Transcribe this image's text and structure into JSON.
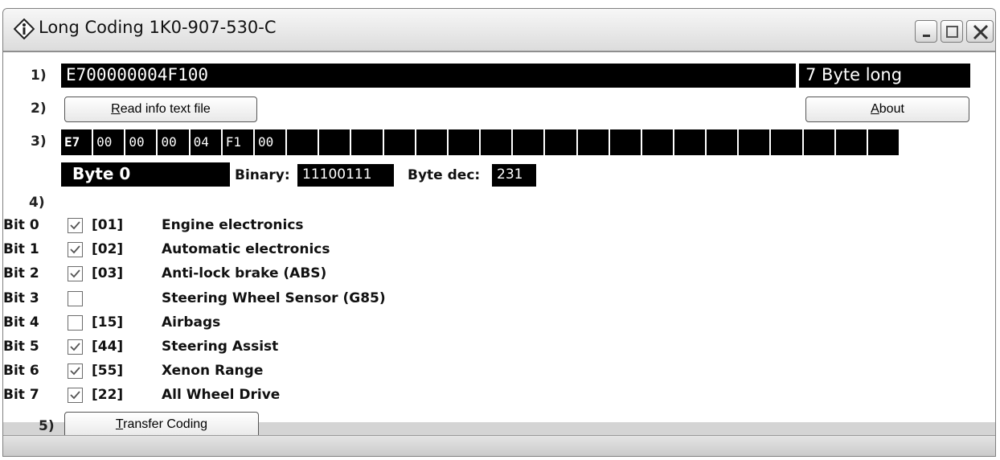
{
  "window": {
    "title": "Long Coding 1K0-907-530-C"
  },
  "rows": {
    "r1": "1)",
    "r2": "2)",
    "r3": "3)",
    "r4": "4)",
    "r5": "5)"
  },
  "coding": {
    "value": "E700000004F100",
    "length": "7 Byte long"
  },
  "buttons": {
    "read_info": {
      "underlined": "R",
      "rest": "ead info text file"
    },
    "about": {
      "underlined": "A",
      "rest": "bout"
    },
    "transfer": {
      "underlined": "T",
      "rest": "ransfer Coding"
    }
  },
  "bytes": [
    "E7",
    "00",
    "00",
    "00",
    "04",
    "F1",
    "00",
    "",
    "",
    "",
    "",
    "",
    "",
    "",
    "",
    "",
    "",
    "",
    "",
    "",
    "",
    "",
    "",
    "",
    "",
    ""
  ],
  "byte_info": {
    "label": "Byte 0",
    "binary_label": "Binary:",
    "binary_value": "11100111",
    "dec_label": "Byte dec:",
    "dec_value": "231"
  },
  "bits": [
    {
      "label": "Bit 0",
      "checked": true,
      "code": "[01]",
      "desc": "Engine electronics"
    },
    {
      "label": "Bit 1",
      "checked": true,
      "code": "[02]",
      "desc": "Automatic electronics"
    },
    {
      "label": "Bit 2",
      "checked": true,
      "code": "[03]",
      "desc": "Anti-lock brake (ABS)"
    },
    {
      "label": "Bit 3",
      "checked": false,
      "code": "",
      "desc": "Steering Wheel Sensor (G85)"
    },
    {
      "label": "Bit 4",
      "checked": false,
      "code": "[15]",
      "desc": "Airbags"
    },
    {
      "label": "Bit 5",
      "checked": true,
      "code": "[44]",
      "desc": "Steering Assist"
    },
    {
      "label": "Bit 6",
      "checked": true,
      "code": "[55]",
      "desc": "Xenon Range"
    },
    {
      "label": "Bit 7",
      "checked": true,
      "code": "[22]",
      "desc": "All Wheel Drive"
    }
  ],
  "icons": {
    "app": "diamond-info-icon",
    "minimize": "minimize-icon",
    "maximize": "maximize-icon",
    "close": "close-icon",
    "check": "checkmark-icon"
  }
}
